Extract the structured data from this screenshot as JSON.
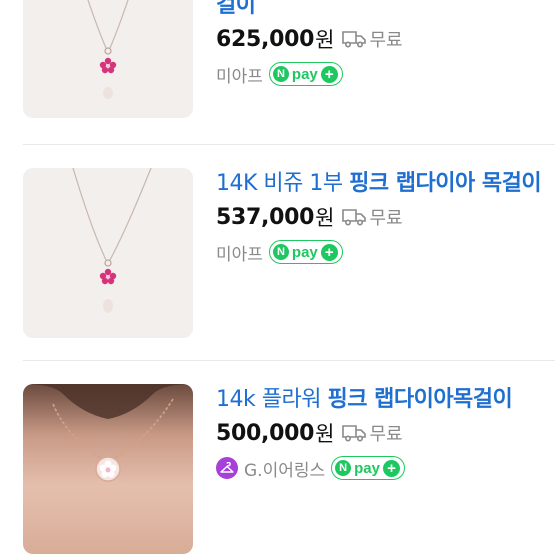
{
  "listings": [
    {
      "title_regular": "",
      "title_highlight": "걸이",
      "price": "625,000",
      "currency": "원",
      "shipping": "무료",
      "seller": "미아프",
      "npay_label": "pay"
    },
    {
      "title_regular": "14K 비쥬 1부 ",
      "title_highlight": "핑크 랩다이아 목걸이",
      "price": "537,000",
      "currency": "원",
      "shipping": "무료",
      "seller": "미아프",
      "npay_label": "pay"
    },
    {
      "title_regular": "14k 플라워 ",
      "title_highlight": "핑크 랩다이아목걸이",
      "price": "500,000",
      "currency": "원",
      "shipping": "무료",
      "seller": "G.이어링스",
      "npay_label": "pay"
    }
  ],
  "colors": {
    "title": "#1f6fd1",
    "npay_green": "#1fc760",
    "seller_badge": "#a640d8"
  }
}
